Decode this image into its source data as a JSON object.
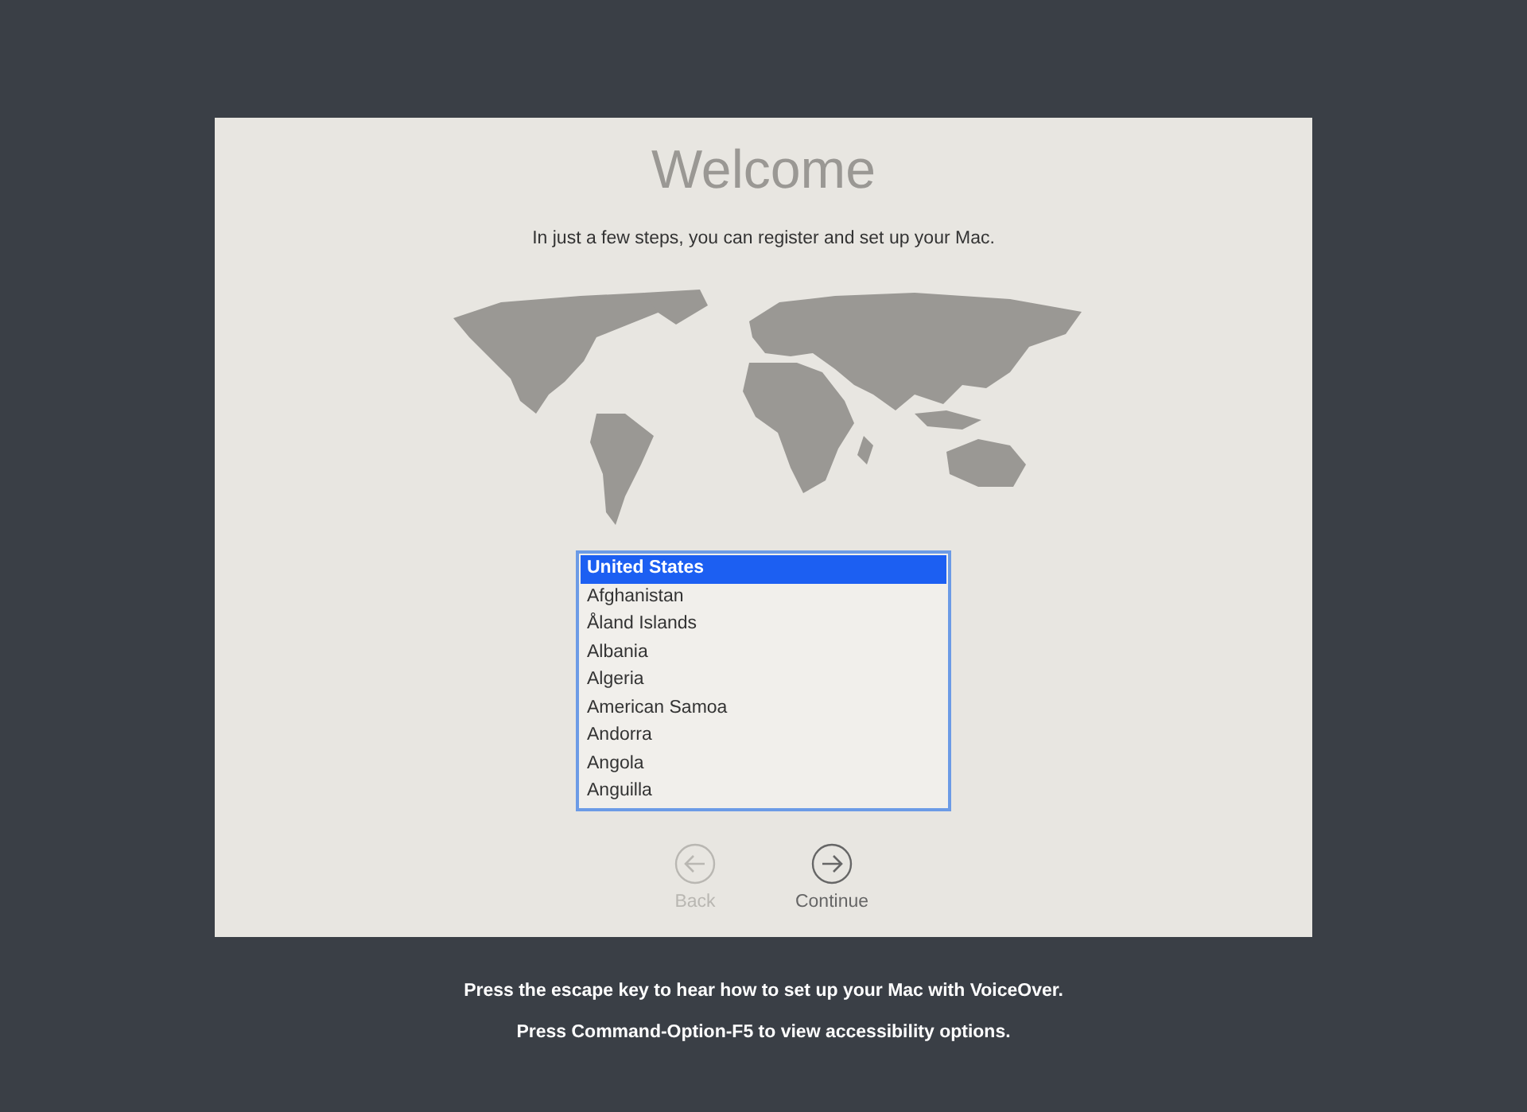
{
  "title": "Welcome",
  "subtitle": "In just a few steps, you can register and set up your Mac.",
  "countries": [
    {
      "label": "United States",
      "selected": true
    },
    {
      "label": "Afghanistan",
      "selected": false
    },
    {
      "label": "Åland Islands",
      "selected": false
    },
    {
      "label": "Albania",
      "selected": false
    },
    {
      "label": "Algeria",
      "selected": false
    },
    {
      "label": "American Samoa",
      "selected": false
    },
    {
      "label": "Andorra",
      "selected": false
    },
    {
      "label": "Angola",
      "selected": false
    },
    {
      "label": "Anguilla",
      "selected": false
    }
  ],
  "buttons": [
    {
      "kind": "back",
      "label": "Back",
      "disabled": true
    },
    {
      "kind": "continue",
      "label": "Continue",
      "disabled": false
    }
  ],
  "hints": [
    "Press the escape key to hear how to set up your Mac with VoiceOver.",
    "Press Command-Option-F5 to view accessibility options."
  ]
}
